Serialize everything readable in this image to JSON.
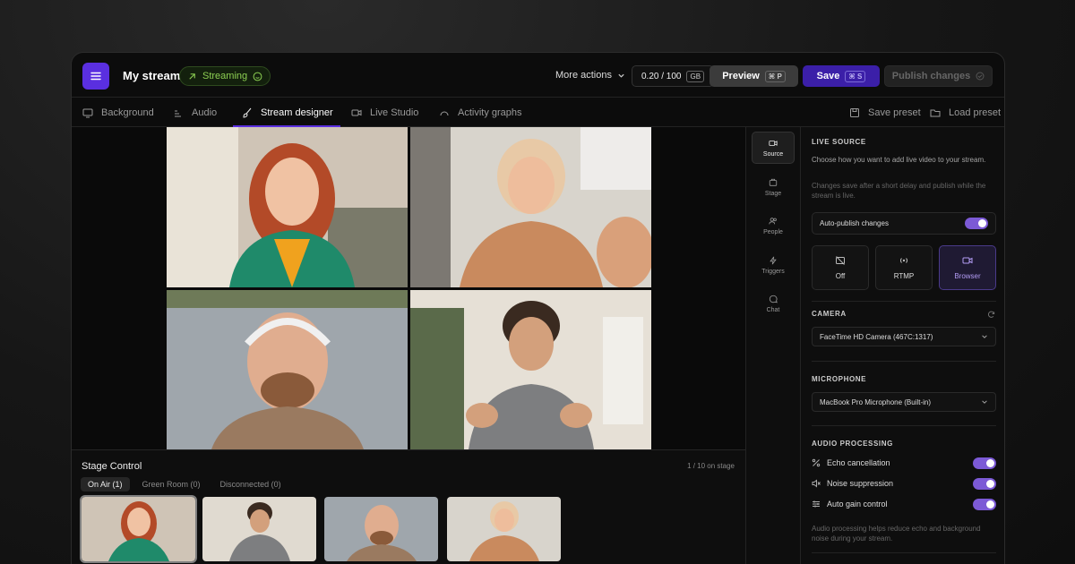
{
  "topbar": {
    "title": "My stream",
    "status": "Streaming",
    "more_actions": "More actions",
    "counter": "0.20 / 100",
    "counter_unit": "GB",
    "preview_label": "Preview",
    "preview_shortcut": "⌘ P",
    "save_label": "Save",
    "save_shortcut": "⌘ S",
    "publish_label": "Publish changes"
  },
  "tabs": [
    {
      "label": "Background",
      "icon": "monitor-icon"
    },
    {
      "label": "Audio",
      "icon": "audio-icon"
    },
    {
      "label": "Stream designer",
      "icon": "brush-icon",
      "active": true
    },
    {
      "label": "Live Studio",
      "icon": "video-icon"
    },
    {
      "label": "Activity graphs",
      "icon": "gauge-icon"
    }
  ],
  "presets": {
    "save": "Save preset",
    "load": "Load preset"
  },
  "stage_control": {
    "title": "Stage Control",
    "count": "1 / 10 on stage",
    "tabs": [
      "On Air (1)",
      "Green Room (0)",
      "Disconnected (0)"
    ]
  },
  "rail": [
    {
      "label": "Source",
      "icon": "video-icon",
      "active": true
    },
    {
      "label": "Stage",
      "icon": "stage-icon"
    },
    {
      "label": "People",
      "icon": "people-icon"
    },
    {
      "label": "Triggers",
      "icon": "bolt-icon"
    },
    {
      "label": "Chat",
      "icon": "chat-icon"
    }
  ],
  "panel": {
    "live_source_heading": "LIVE SOURCE",
    "live_source_desc": "Choose how you want to add live video to your stream.",
    "live_source_note": "Changes save after a short delay and publish while the stream is live.",
    "auto_publish": "Auto-publish changes",
    "sources": [
      "Off",
      "RTMP",
      "Browser"
    ],
    "camera_heading": "CAMERA",
    "camera_value": "FaceTime HD Camera (467C:1317)",
    "mic_heading": "MICROPHONE",
    "mic_value": "MacBook Pro Microphone (Built-in)",
    "audio_heading": "AUDIO PROCESSING",
    "audio_options": [
      "Echo cancellation",
      "Noise suppression",
      "Auto gain control"
    ],
    "audio_note": "Audio processing helps reduce echo and background noise during your stream."
  },
  "colors": {
    "accent": "#5a2fe0",
    "status_green": "#8ccf52",
    "toggle": "#7c5ad6"
  }
}
